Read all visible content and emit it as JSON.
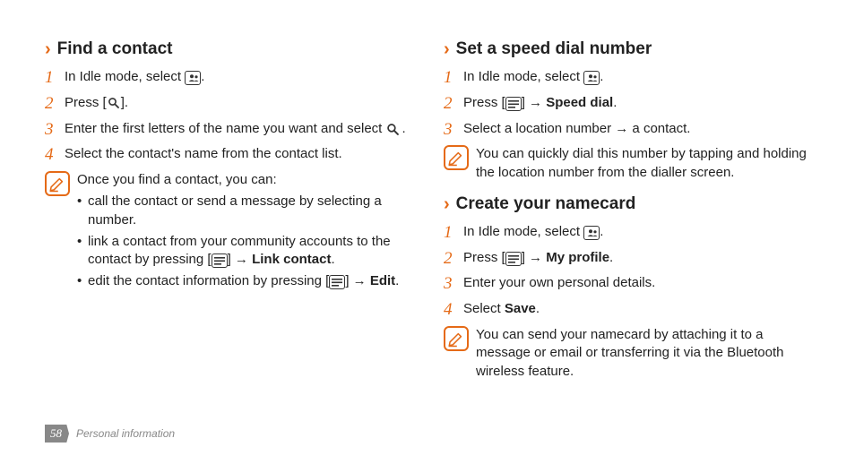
{
  "left": {
    "find": {
      "title": "Find a contact",
      "step1a": "In Idle mode, select ",
      "step1b": ".",
      "step2a": "Press [",
      "step2b": "].",
      "step3a": "Enter the first letters of the name you want and select ",
      "step3b": ".",
      "step4": "Select the contact's name from the contact list.",
      "note_intro": "Once you find a contact, you can:",
      "bullet1": "call the contact or send a message by selecting a number.",
      "bullet2a": "link a contact from your community accounts to the contact by pressing [",
      "bullet2b": "] → ",
      "bullet2c": "Link contact",
      "bullet2d": ".",
      "bullet3a": "edit the contact information by pressing [",
      "bullet3b": "] → ",
      "bullet3c": "Edit",
      "bullet3d": "."
    }
  },
  "right": {
    "speed": {
      "title": "Set a speed dial number",
      "step1a": "In Idle mode, select ",
      "step1b": ".",
      "step2a": "Press [",
      "step2b": "] → ",
      "step2c": "Speed dial",
      "step2d": ".",
      "step3": "Select a location number → a contact.",
      "note": "You can quickly dial this number by tapping and holding the location number from the dialler screen."
    },
    "namecard": {
      "title": "Create your namecard",
      "step1a": "In Idle mode, select ",
      "step1b": ".",
      "step2a": "Press [",
      "step2b": "] → ",
      "step2c": "My profile",
      "step2d": ".",
      "step3": "Enter your own personal details.",
      "step4a": "Select ",
      "step4b": "Save",
      "step4c": ".",
      "note": "You can send your namecard by attaching it to a message or email or transferring it via the Bluetooth wireless feature."
    }
  },
  "footer": {
    "page": "58",
    "section": "Personal information"
  },
  "nums": {
    "n1": "1",
    "n2": "2",
    "n3": "3",
    "n4": "4"
  }
}
